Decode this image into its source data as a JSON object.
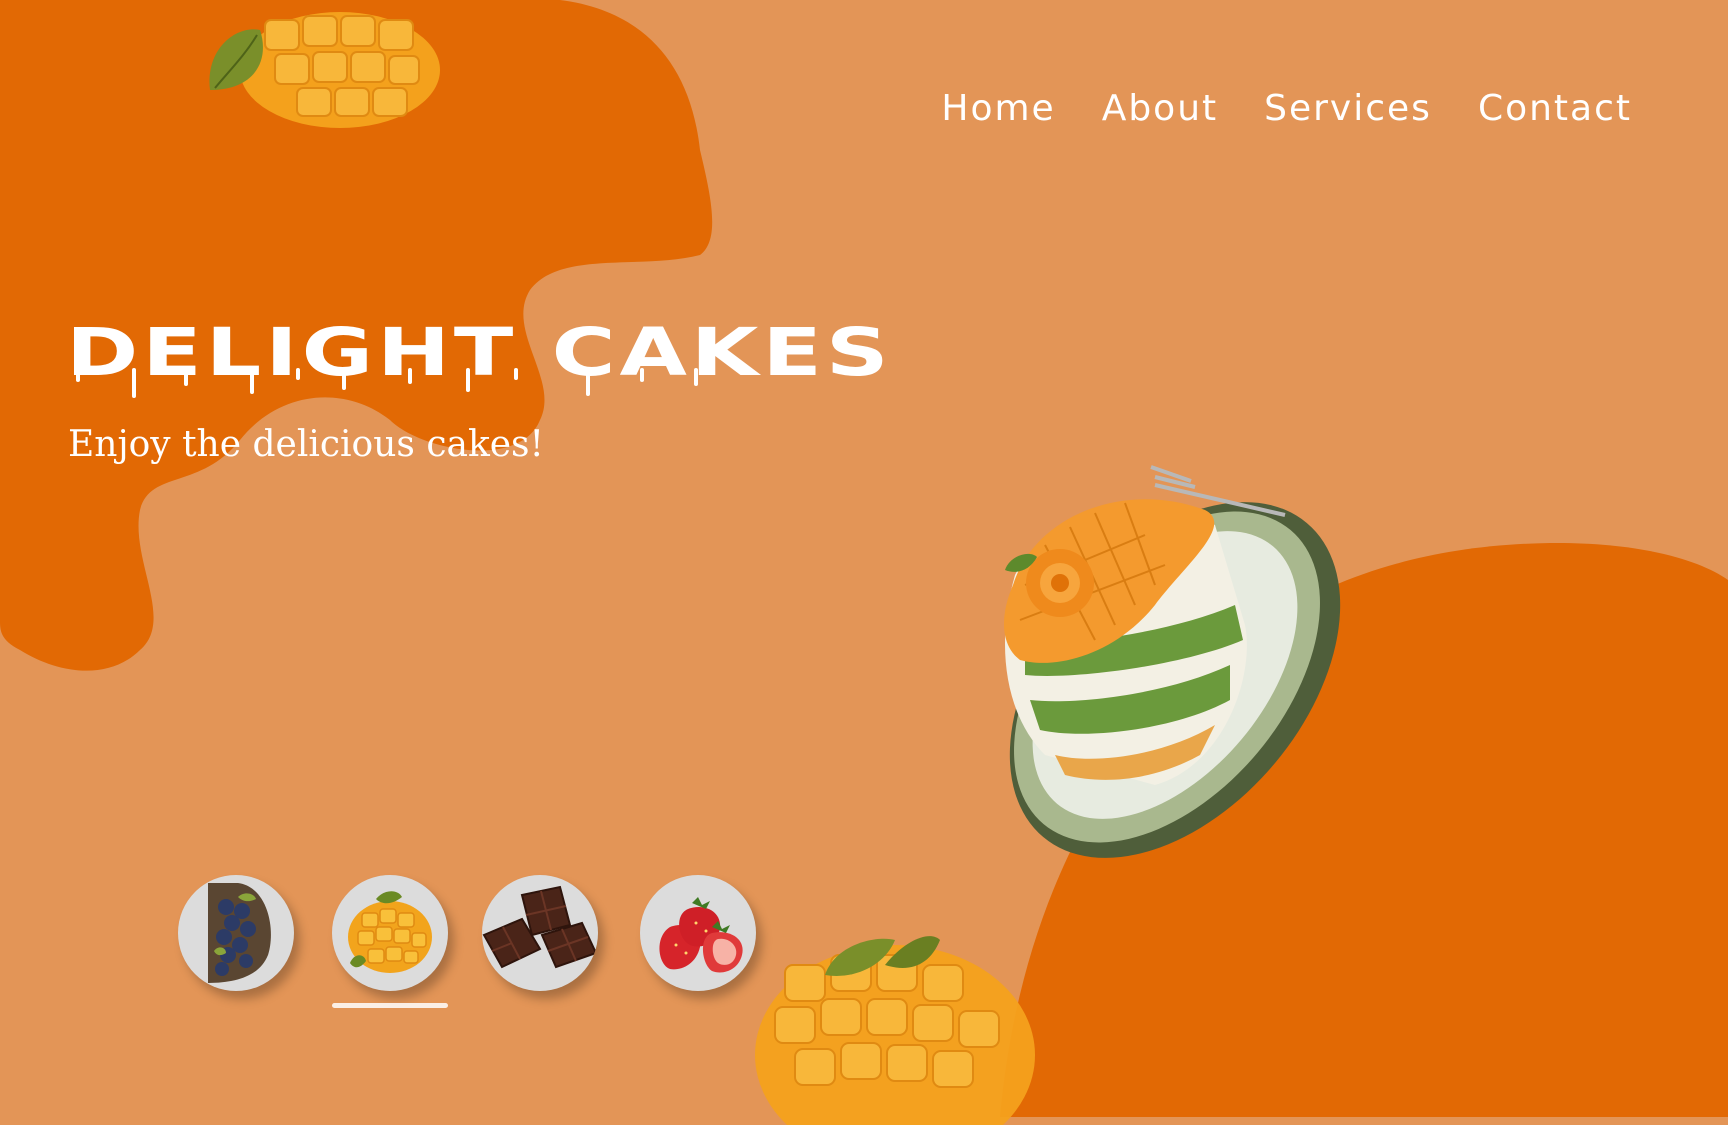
{
  "colors": {
    "background": "#e39557",
    "accent": "#e26904",
    "text": "#ffffff"
  },
  "nav": {
    "items": [
      {
        "label": "Home"
      },
      {
        "label": "About"
      },
      {
        "label": "Services"
      },
      {
        "label": "Contact"
      }
    ]
  },
  "hero": {
    "title": "DELIGHT CAKES",
    "subtitle": "Enjoy the delicious cakes!"
  },
  "images": {
    "main": "mango-layer-cake-on-plate",
    "decor_top": "cut-mango",
    "decor_bottom": "cut-mango"
  },
  "flavors": {
    "selected_index": 1,
    "items": [
      {
        "name": "blueberry",
        "icon": "blueberry-icon"
      },
      {
        "name": "mango",
        "icon": "mango-icon"
      },
      {
        "name": "chocolate",
        "icon": "chocolate-icon"
      },
      {
        "name": "strawberry",
        "icon": "strawberry-icon"
      }
    ]
  }
}
